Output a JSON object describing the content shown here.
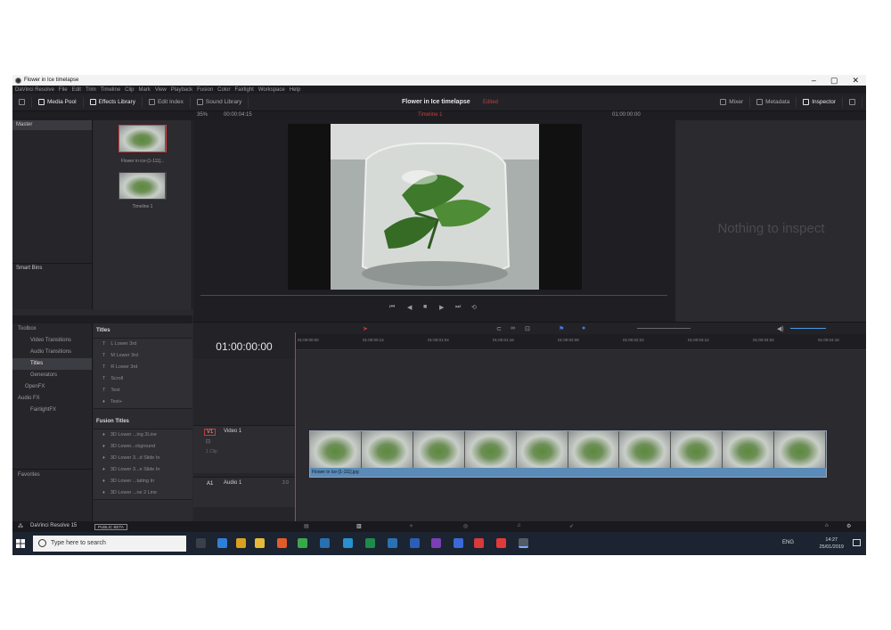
{
  "window": {
    "title": "Flower in Ice timelapse",
    "controls": [
      "–",
      "▢",
      "✕"
    ]
  },
  "menu": [
    "DaVinci Resolve",
    "File",
    "Edit",
    "Trim",
    "Timeline",
    "Clip",
    "Mark",
    "View",
    "Playback",
    "Fusion",
    "Color",
    "Fairlight",
    "Workspace",
    "Help"
  ],
  "toolbar": {
    "media_pool": "Media Pool",
    "effects_library": "Effects Library",
    "edit_index": "Edit Index",
    "sound_library": "Sound Library",
    "project_title": "Flower in Ice timelapse",
    "project_status": "Edited",
    "mixer": "Mixer",
    "metadata": "Metadata",
    "inspector": "Inspector"
  },
  "subbar": {
    "zoom": "35%",
    "source_tc": "00:00:04:15",
    "timeline_name": "Timeline 1",
    "record_tc": "01:00:00:00"
  },
  "bins": {
    "master": "Master",
    "smart_bins": "Smart Bins"
  },
  "media_pool": {
    "clip_label": "Flower in ice-[1-111]...",
    "timeline_label": "Timeline 1"
  },
  "inspector": {
    "empty_text": "Nothing to inspect"
  },
  "toolbox": {
    "root": "Toolbox",
    "items": [
      "Video Transitions",
      "Audio Transitions",
      "Titles",
      "Generators"
    ],
    "openfx": "OpenFX",
    "audiofx": "Audio FX",
    "fairlight": "FairlightFX",
    "favorites": "Favorites"
  },
  "titles": {
    "header": "Titles",
    "items": [
      "L Lower 3rd",
      "M Lower 3rd",
      "R Lower 3rd",
      "Scroll",
      "Text",
      "Text+"
    ],
    "fusion_header": "Fusion Titles",
    "fusion_items": [
      "3D Lower ...ing 2Line",
      "3D Lower...ckground",
      "3D Lower 3...d Slide In",
      "3D Lower 3...e Slide In",
      "3D Lower ...tating In",
      "3D Lower ...ne 2 Line"
    ]
  },
  "timeline": {
    "timecode": "01:00:00:00",
    "ruler": [
      "01:00:00:00",
      "01:00:00:14",
      "01:00:01:04",
      "01:00:01:18",
      "01:00:02:08",
      "01:00:02:22",
      "01:00:03:12",
      "01:00:04:02",
      "01:00:04:16"
    ],
    "video_track_tag": "V1",
    "video_track_name": "Video 1",
    "video_clip_count": "1 Clip",
    "audio_track_tag": "A1",
    "audio_track_name": "Audio 1",
    "audio_channels": "2.0",
    "clip_name": "Flower in ice-[1-111].jpg"
  },
  "footer": {
    "app_name": "DaVinci Resolve 15",
    "badge": "PUBLIC BETA"
  },
  "taskbar": {
    "search_placeholder": "Type here to search",
    "lang": "ENG",
    "time": "14:27",
    "date": "25/01/2019"
  }
}
